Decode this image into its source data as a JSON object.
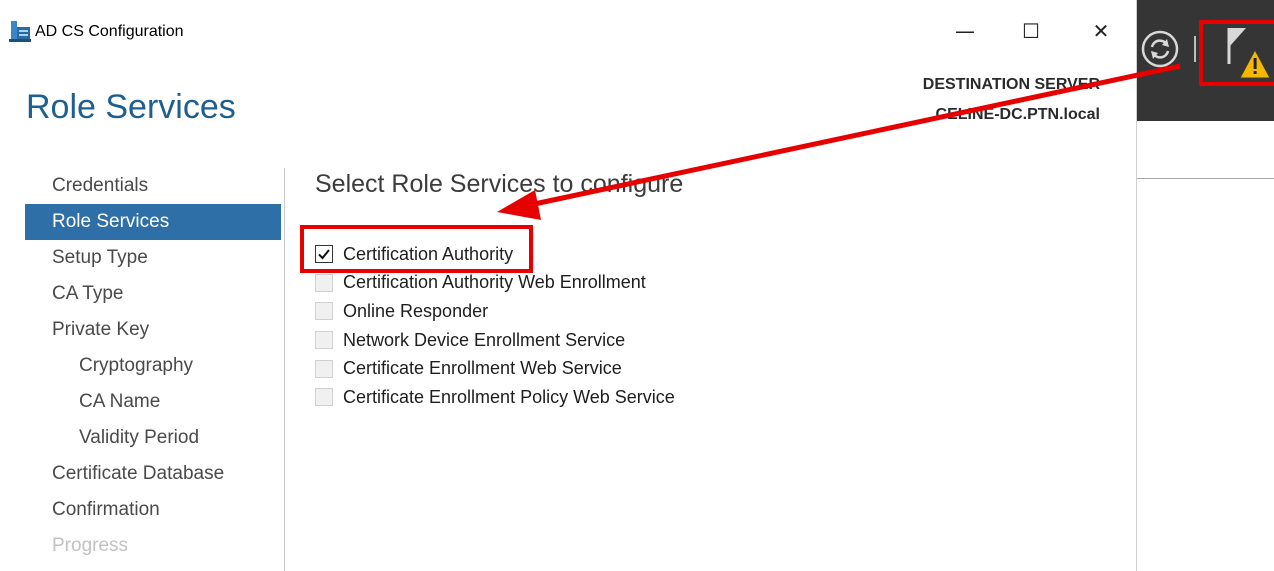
{
  "window": {
    "title": "AD CS Configuration",
    "minimize_glyph": "—",
    "maximize_glyph": "☐",
    "close_glyph": "✕"
  },
  "header": {
    "page_title": "Role Services",
    "destination_label": "DESTINATION SERVER",
    "destination_server": "CELINE-DC.PTN.local"
  },
  "nav": {
    "items": [
      {
        "label": "Credentials"
      },
      {
        "label": "Role Services"
      },
      {
        "label": "Setup Type"
      },
      {
        "label": "CA Type"
      },
      {
        "label": "Private Key"
      },
      {
        "label": "Cryptography"
      },
      {
        "label": "CA Name"
      },
      {
        "label": "Validity Period"
      },
      {
        "label": "Certificate Database"
      },
      {
        "label": "Confirmation"
      },
      {
        "label": "Progress"
      }
    ]
  },
  "content": {
    "section_title": "Select Role Services to configure",
    "roles": [
      {
        "label": "Certification Authority",
        "checked": true
      },
      {
        "label": "Certification Authority Web Enrollment",
        "checked": false
      },
      {
        "label": "Online Responder",
        "checked": false
      },
      {
        "label": "Network Device Enrollment Service",
        "checked": false
      },
      {
        "label": "Certificate Enrollment Web Service",
        "checked": false
      },
      {
        "label": "Certificate Enrollment Policy Web Service",
        "checked": false
      }
    ]
  },
  "background_app": {
    "icons": [
      "refresh-icon",
      "notification-flag-icon",
      "warning-icon"
    ]
  },
  "colors": {
    "accent": "#2f6fa8",
    "title_blue": "#1f5f8f",
    "annotation_red": "#e60000",
    "warning_yellow": "#f5b800"
  }
}
